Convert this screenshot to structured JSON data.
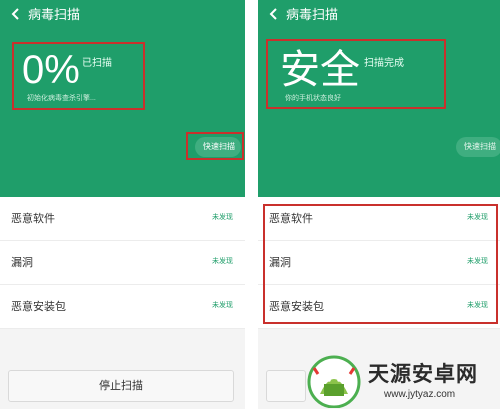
{
  "left_panel": {
    "title": "病毒扫描",
    "big_value": "0%",
    "status": "已扫描",
    "subtitle": "初始化病毒查杀引擎...",
    "quick_scan": "快速扫描",
    "rows": [
      {
        "label": "恶意软件",
        "value": "未发现"
      },
      {
        "label": "漏洞",
        "value": "未发现"
      },
      {
        "label": "恶意安装包",
        "value": "未发现"
      }
    ],
    "stop_button": "停止扫描"
  },
  "right_panel": {
    "title": "病毒扫描",
    "big_value": "安全",
    "status": "扫描完成",
    "subtitle": "你的手机状态良好",
    "quick_scan": "快速扫描",
    "rows": [
      {
        "label": "恶意软件",
        "value": "未发现"
      },
      {
        "label": "漏洞",
        "value": "未发现"
      },
      {
        "label": "恶意安装包",
        "value": "未发现"
      }
    ]
  },
  "watermark": {
    "name": "天源安卓网",
    "url": "www.jytyaz.com"
  },
  "colors": {
    "accent": "#1f9e6a",
    "highlight": "#c9302c"
  }
}
